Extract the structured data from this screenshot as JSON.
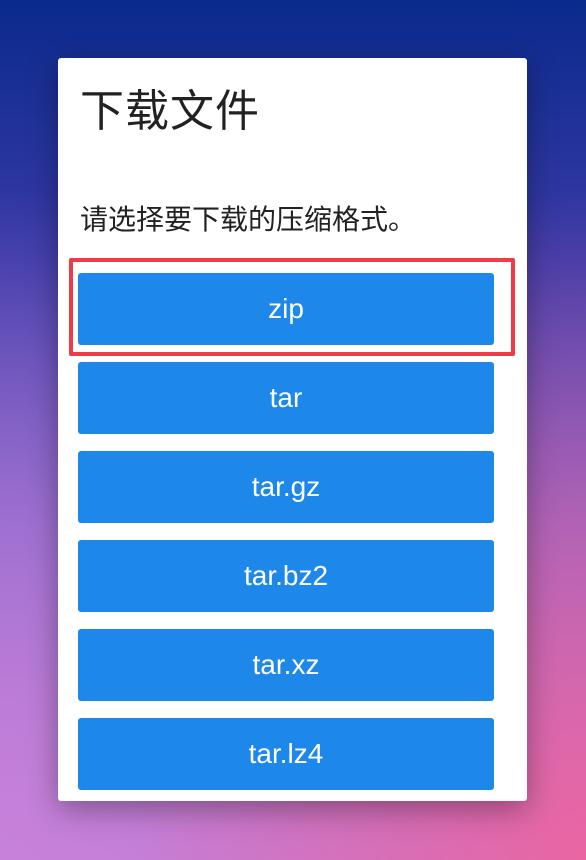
{
  "dialog": {
    "title": "下载文件",
    "description": "请选择要下载的压缩格式。",
    "formats": [
      {
        "label": "zip"
      },
      {
        "label": "tar"
      },
      {
        "label": "tar.gz"
      },
      {
        "label": "tar.bz2"
      },
      {
        "label": "tar.xz"
      },
      {
        "label": "tar.lz4"
      }
    ]
  },
  "colors": {
    "button_background": "#1e88ea",
    "highlight_border": "#f03a48"
  }
}
